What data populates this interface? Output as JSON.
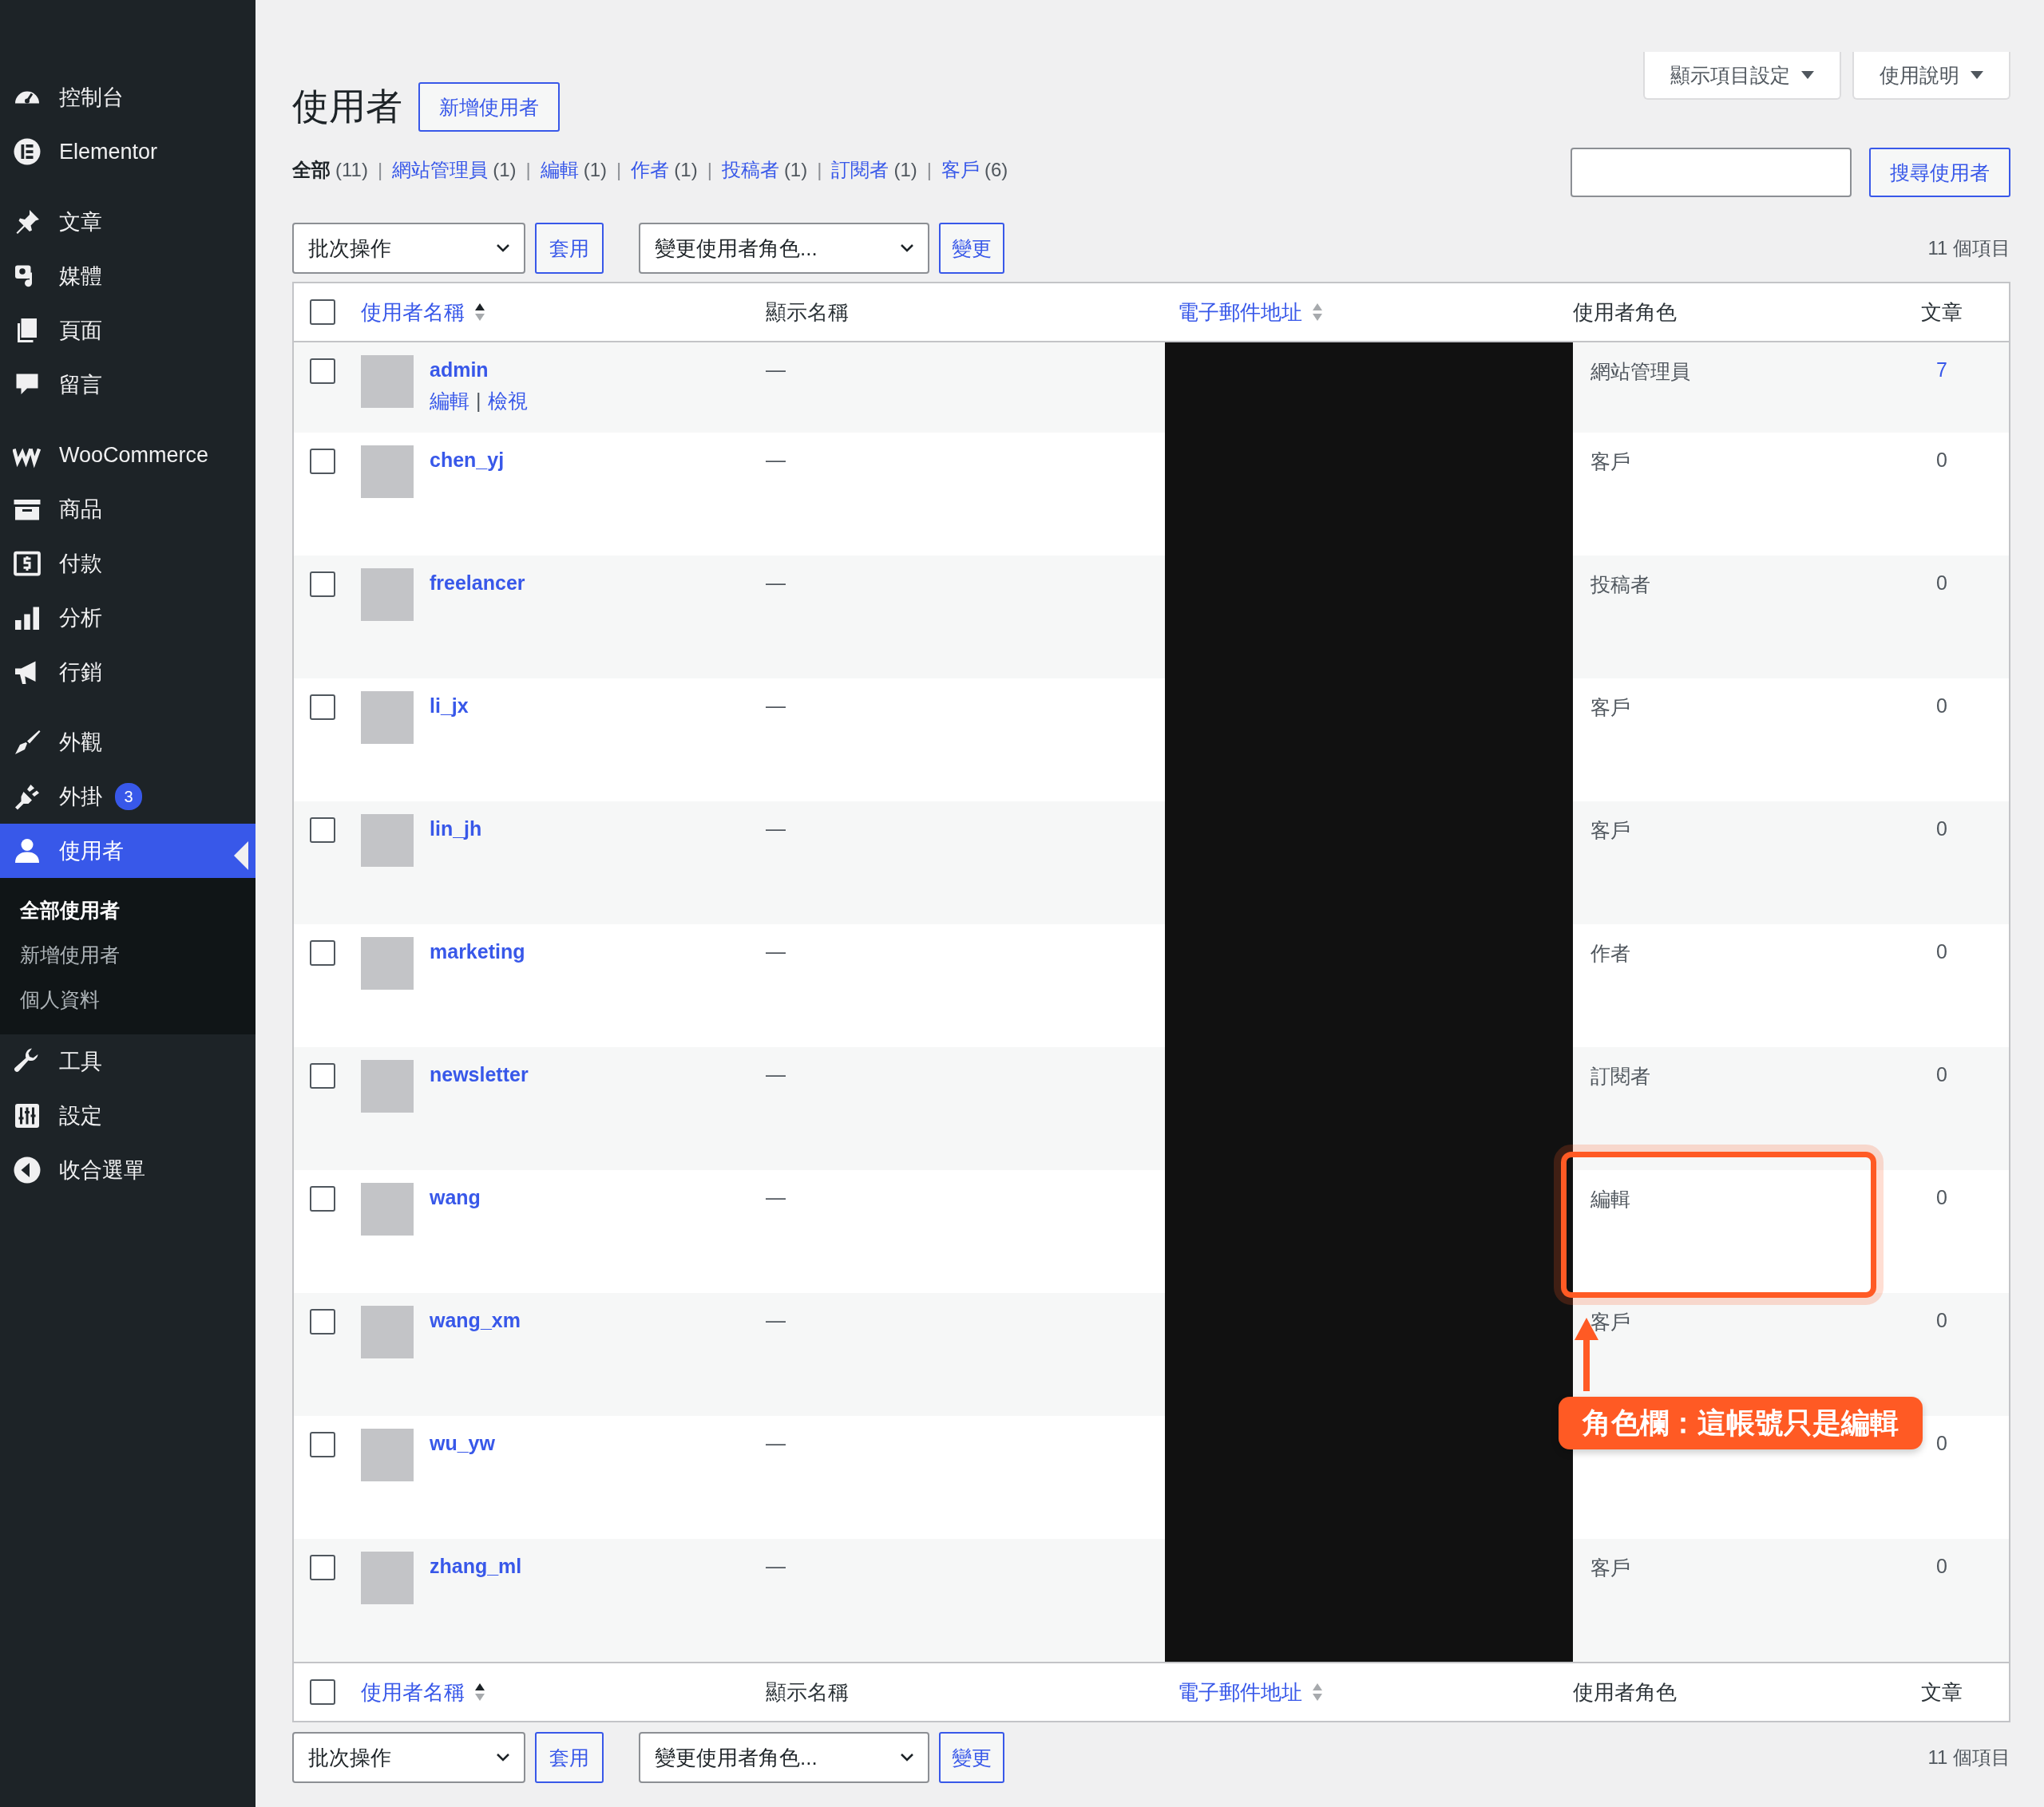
{
  "sidebar": {
    "groups": [
      {
        "items": [
          {
            "label": "控制台",
            "kind": "gauge",
            "selected": false
          },
          {
            "label": "Elementor",
            "kind": "elementor",
            "selected": false
          }
        ]
      },
      {
        "items": [
          {
            "label": "文章",
            "kind": "pin",
            "selected": false
          },
          {
            "label": "媒體",
            "kind": "media",
            "selected": false
          },
          {
            "label": "頁面",
            "kind": "pages",
            "selected": false
          },
          {
            "label": "留言",
            "kind": "bubble",
            "selected": false
          }
        ]
      },
      {
        "items": [
          {
            "label": "WooCommerce",
            "kind": "woo",
            "selected": false
          },
          {
            "label": "商品",
            "kind": "archive",
            "selected": false
          },
          {
            "label": "付款",
            "kind": "dollar",
            "selected": false
          },
          {
            "label": "分析",
            "kind": "bars",
            "selected": false
          },
          {
            "label": "行銷",
            "kind": "megaphone",
            "selected": false
          }
        ]
      },
      {
        "items": [
          {
            "label": "外觀",
            "kind": "brush",
            "selected": false
          },
          {
            "label": "外掛",
            "kind": "plug",
            "selected": false,
            "badge": "3"
          },
          {
            "label": "使用者",
            "kind": "person",
            "selected": true,
            "children": [
              {
                "label": "全部使用者",
                "selected": true
              },
              {
                "label": "新增使用者",
                "selected": false
              },
              {
                "label": "個人資料",
                "selected": false
              }
            ]
          },
          {
            "label": "工具",
            "kind": "wrench",
            "selected": false
          },
          {
            "label": "設定",
            "kind": "sliders",
            "selected": false
          },
          {
            "label": "收合選單",
            "kind": "collapse",
            "selected": false
          }
        ]
      }
    ]
  },
  "screen_meta": [
    "顯示項目設定",
    "使用說明"
  ],
  "title": "使用者",
  "add_button": "新增使用者",
  "filters": [
    {
      "label": "全部",
      "count": "(11)",
      "selected": true
    },
    {
      "separator": "|",
      "label": "網站管理員",
      "count": "(1)",
      "selected": false
    },
    {
      "separator": "|",
      "label": "編輯",
      "count": "(1)",
      "selected": false
    },
    {
      "separator": "|",
      "label": "作者",
      "count": "(1)",
      "selected": false
    },
    {
      "separator": "|",
      "label": "投稿者",
      "count": "(1)",
      "selected": false
    },
    {
      "separator": "|",
      "label": "訂閱者",
      "count": "(1)",
      "selected": false
    },
    {
      "separator": "|",
      "label": "客戶",
      "count": "(6)",
      "selected": false
    }
  ],
  "search_button": "搜尋使用者",
  "tablenav_top": {
    "bulk": "批次操作",
    "apply": "套用",
    "role": "變更使用者角色...",
    "change": "變更",
    "count": "11 個項目"
  },
  "select_all": {
    "checked": false
  },
  "columns": [
    {
      "label": "使用者名稱",
      "sortable": true,
      "sorted": true
    },
    {
      "label": "顯示名稱",
      "sortable": false,
      "sorted": false
    },
    {
      "label": "電子郵件地址",
      "sortable": true,
      "sorted": false
    },
    {
      "label": "使用者角色",
      "sortable": false,
      "sorted": false
    },
    {
      "label": "文章",
      "sortable": false,
      "sorted": false
    }
  ],
  "rows": [
    {
      "username": "admin",
      "display_name": "—",
      "role": "網站管理員",
      "posts": "7",
      "linked": true,
      "checked": false,
      "actions": [
        {
          "label": "編輯"
        },
        {
          "separator": "|",
          "label": "檢視"
        }
      ]
    },
    {
      "username": "chen_yj",
      "display_name": "—",
      "role": "客戶",
      "posts": "0",
      "linked": false,
      "checked": false
    },
    {
      "username": "freelancer",
      "display_name": "—",
      "role": "投稿者",
      "posts": "0",
      "linked": false,
      "checked": false
    },
    {
      "username": "li_jx",
      "display_name": "—",
      "role": "客戶",
      "posts": "0",
      "linked": false,
      "checked": false
    },
    {
      "username": "lin_jh",
      "display_name": "—",
      "role": "客戶",
      "posts": "0",
      "linked": false,
      "checked": false
    },
    {
      "username": "marketing",
      "display_name": "—",
      "role": "作者",
      "posts": "0",
      "linked": false,
      "checked": false
    },
    {
      "username": "newsletter",
      "display_name": "—",
      "role": "訂閱者",
      "posts": "0",
      "linked": false,
      "checked": false
    },
    {
      "username": "wang",
      "display_name": "—",
      "role": "編輯",
      "posts": "0",
      "linked": false,
      "checked": false
    },
    {
      "username": "wang_xm",
      "display_name": "—",
      "role": "客戶",
      "posts": "0",
      "linked": false,
      "checked": false
    },
    {
      "username": "wu_yw",
      "display_name": "—",
      "posts": "0",
      "linked": false,
      "checked": false
    },
    {
      "username": "zhang_ml",
      "display_name": "—",
      "role": "客戶",
      "posts": "0",
      "linked": false,
      "checked": false
    }
  ],
  "footer_select_all": {
    "checked": false
  },
  "footer_columns": [
    {
      "label": "使用者名稱",
      "sortable": true,
      "sorted": true
    },
    {
      "label": "顯示名稱",
      "sortable": false,
      "sorted": false
    },
    {
      "label": "電子郵件地址",
      "sortable": true,
      "sorted": false
    },
    {
      "label": "使用者角色",
      "sortable": false,
      "sorted": false
    },
    {
      "label": "文章",
      "sortable": false,
      "sorted": false
    }
  ],
  "tablenav_bottom": {
    "bulk": "批次操作",
    "apply": "套用",
    "role": "變更使用者角色...",
    "change": "變更",
    "count": "11 個項目"
  },
  "annotation": {
    "callout": "角色欄：這帳號只是編輯"
  }
}
